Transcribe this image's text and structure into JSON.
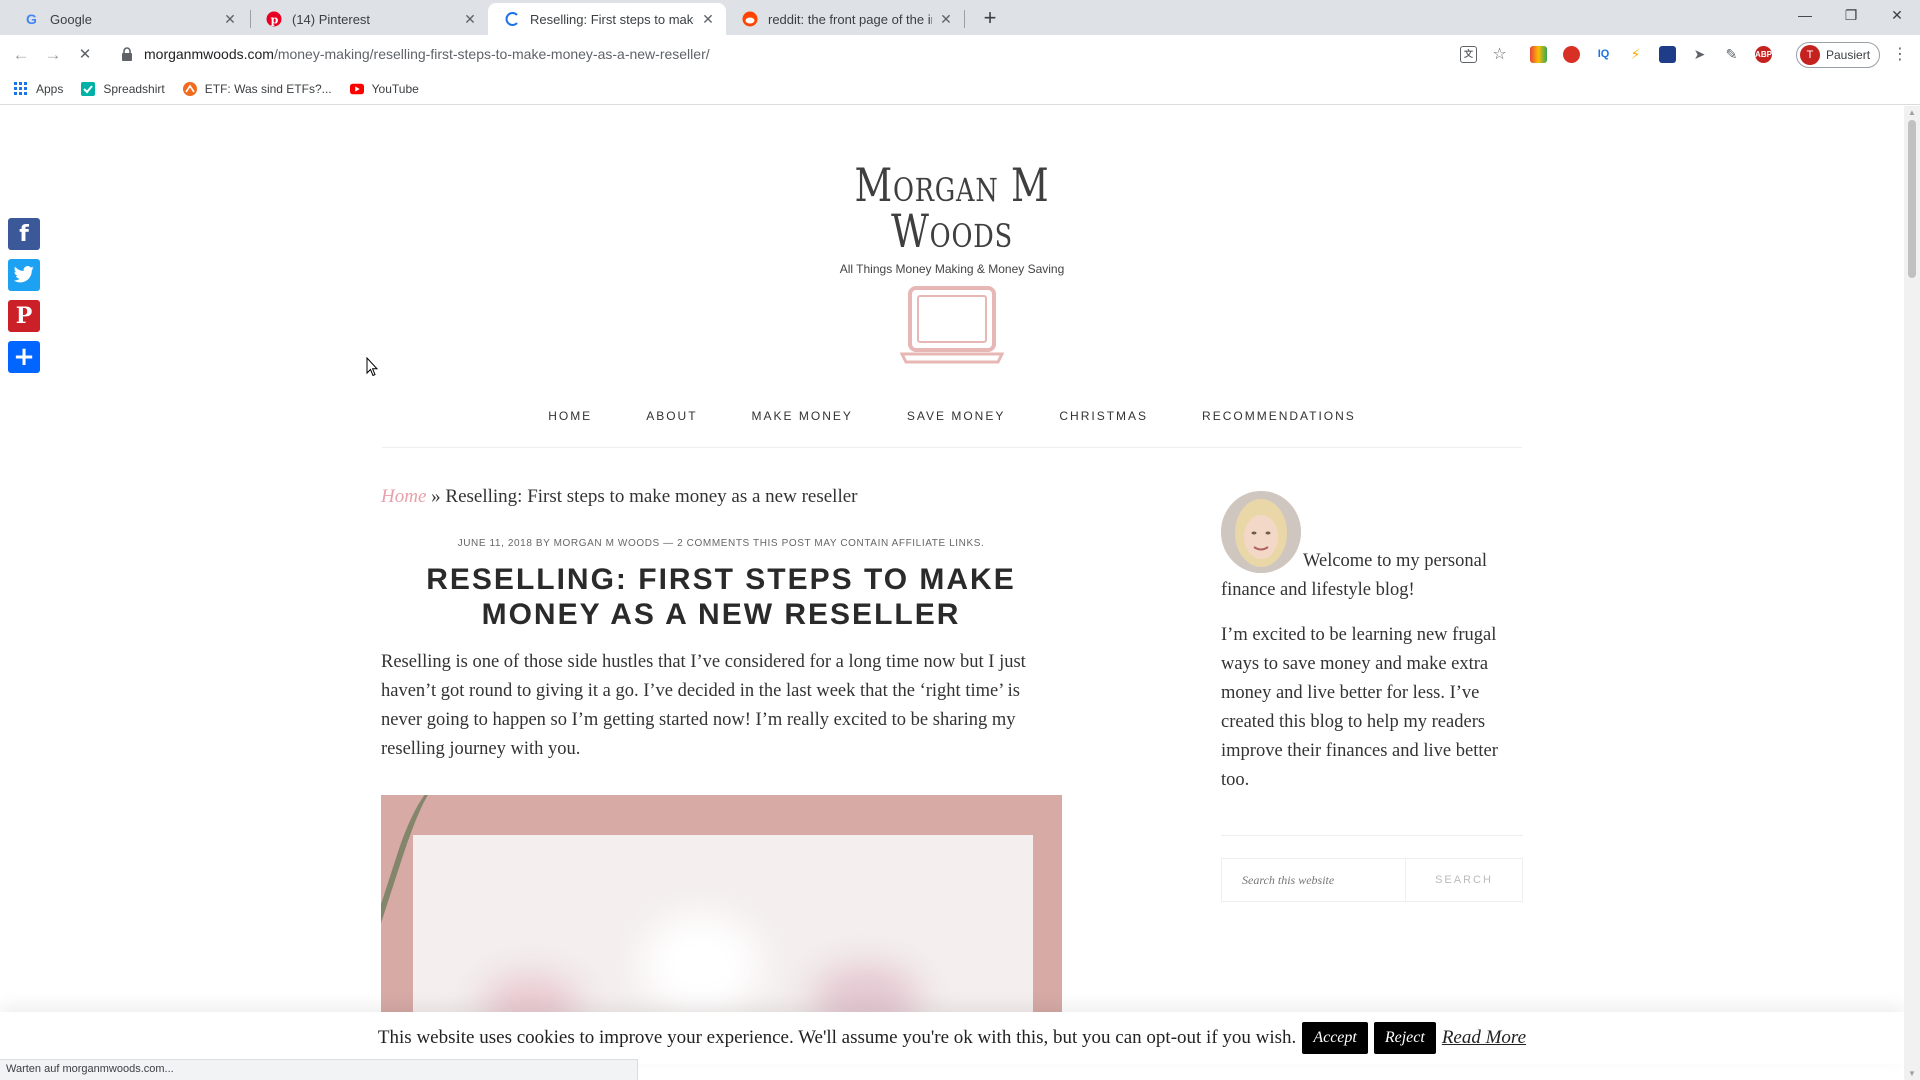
{
  "browser": {
    "tabs": [
      {
        "title": "Google",
        "favicon": "google-icon"
      },
      {
        "title": "(14) Pinterest",
        "favicon": "pinterest-icon"
      },
      {
        "title": "Reselling: First steps to make mo",
        "favicon": "loading-icon",
        "active": true
      },
      {
        "title": "reddit: the front page of the inte",
        "favicon": "reddit-icon"
      }
    ],
    "url_host": "morganmwoods.com",
    "url_path": "/money-making/reselling-first-steps-to-make-money-as-a-new-reseller/",
    "profile_initial": "T",
    "profile_label": "Pausiert",
    "bookmarks": [
      {
        "label": "Apps",
        "icon": "apps-grid-icon"
      },
      {
        "label": "Spreadshirt",
        "icon": "spreadshirt-icon"
      },
      {
        "label": "ETF: Was sind ETFs?...",
        "icon": "etf-icon"
      },
      {
        "label": "YouTube",
        "icon": "youtube-icon"
      }
    ],
    "status_text": "Warten auf morganmwoods.com..."
  },
  "site": {
    "logo_name": "Morgan M Woods",
    "tagline": "All Things Money Making & Money Saving",
    "nav": [
      "HOME",
      "ABOUT",
      "MAKE MONEY",
      "SAVE MONEY",
      "CHRISTMAS",
      "RECOMMENDATIONS"
    ],
    "share": [
      "facebook",
      "twitter",
      "pinterest",
      "share"
    ]
  },
  "article": {
    "breadcrumb_home": "Home",
    "breadcrumb_sep": "»",
    "breadcrumb_current": "Reselling: First steps to make money as a new reseller",
    "meta": "JUNE 11, 2018 BY MORGAN M WOODS — 2 COMMENTS THIS POST MAY CONTAIN AFFILIATE LINKS.",
    "title": "RESELLING: FIRST STEPS TO MAKE MONEY AS A NEW RESELLER",
    "body": "Reselling is one of those side hustles that I’ve considered for a long time now but I just haven’t got round to giving it a go. I’ve decided in the last week that the ‘right time’ is never going to happen so I’m getting started now! I’m really excited to be sharing my reselling journey with you."
  },
  "sidebar": {
    "welcome": "Welcome to my personal finance and lifestyle blog!",
    "about": "I’m excited to be learning new frugal ways to save money and make extra money and live better for less. I’ve created this blog to help my readers improve their finances and live better too.",
    "search_placeholder": "Search this website",
    "search_button": "SEARCH"
  },
  "cookie": {
    "message": "This website uses cookies to improve your experience. We'll assume you're ok with this, but you can opt-out if you wish.",
    "accept": "Accept",
    "reject": "Reject",
    "read_more": "Read More"
  },
  "colors": {
    "accent_pink": "#e8a0aa",
    "facebook": "#3b5998",
    "twitter": "#1da1f2",
    "pinterest": "#cb2027",
    "share": "#0166ff"
  }
}
